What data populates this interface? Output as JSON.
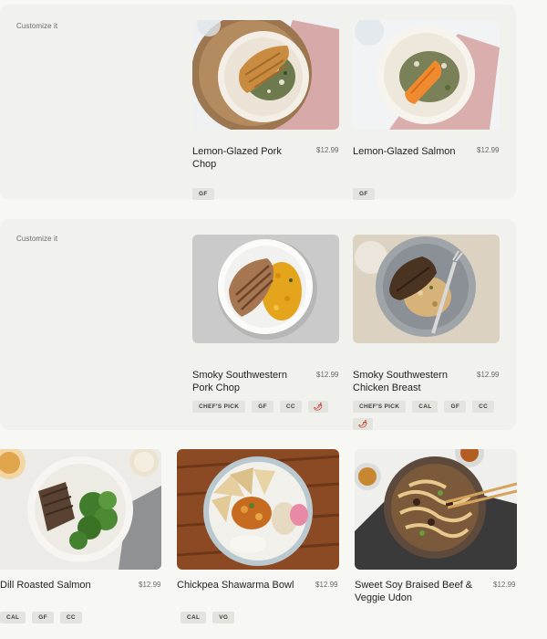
{
  "sections": [
    {
      "customize_label": "Customize it",
      "items": [
        {
          "name": "Lemon-Glazed Pork Chop",
          "price": "$12.99",
          "tags": [
            "GF"
          ]
        },
        {
          "name": "Lemon-Glazed Salmon",
          "price": "$12.99",
          "tags": [
            "GF"
          ]
        }
      ]
    },
    {
      "customize_label": "Customize it",
      "items": [
        {
          "name": "Smoky Southwestern Pork Chop",
          "price": "$12.99",
          "tags": [
            "CHEF'S PICK",
            "GF",
            "CC"
          ],
          "spicy_icon": "chili-pepper-icon"
        },
        {
          "name": "Smoky Southwestern Chicken Breast",
          "price": "$12.99",
          "tags": [
            "CHEF'S PICK",
            "CAL",
            "GF",
            "CC"
          ],
          "spicy_icon": "chili-pepper-icon"
        }
      ]
    }
  ],
  "grid_items": [
    {
      "name": "Dill Roasted Salmon",
      "price": "$12.99",
      "tags": [
        "CAL",
        "GF",
        "CC"
      ]
    },
    {
      "name": "Chickpea Shawarma Bowl",
      "price": "$12.99",
      "tags": [
        "CAL",
        "VG"
      ]
    },
    {
      "name": "Sweet Soy Braised Beef & Veggie Udon",
      "price": "$12.99",
      "tags": []
    }
  ],
  "colors": {
    "page_bg": "#f7f7f4",
    "section_bg": "#f1f1ed",
    "tag_bg": "#e4e4df",
    "spicy": "#c8382d"
  }
}
